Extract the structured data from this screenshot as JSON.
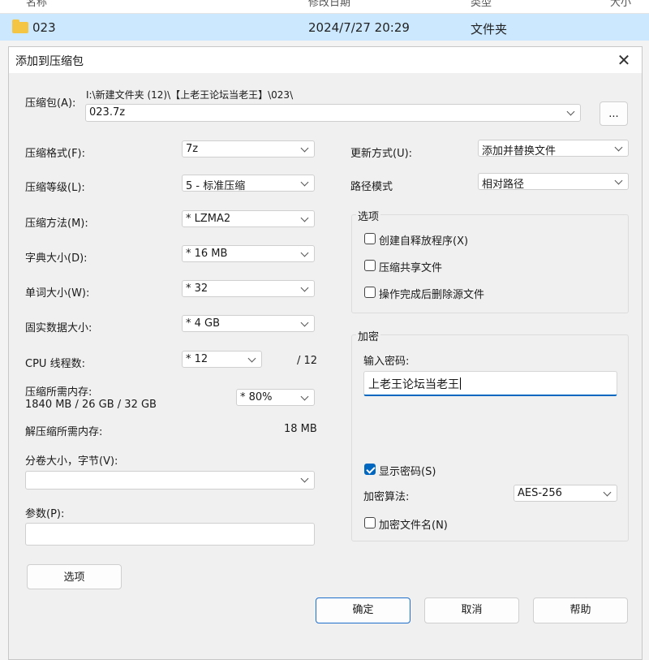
{
  "explorer": {
    "header_name": "名称",
    "header_modified": "修改日期",
    "header_type": "类型",
    "header_size": "大小",
    "row": {
      "name": "023",
      "modified": "2024/7/27 20:29",
      "type": "文件夹"
    }
  },
  "dialog": {
    "title": "添加到压缩包",
    "archive": {
      "label": "压缩包(A):",
      "path": "I:\\新建文件夹 (12)\\【上老王论坛当老王】\\023\\",
      "value": "023.7z",
      "browse_label": "..."
    },
    "left": {
      "format": {
        "label": "压缩格式(F):",
        "value": "7z"
      },
      "level": {
        "label": "压缩等级(L):",
        "value": "5 - 标准压缩"
      },
      "method": {
        "label": "压缩方法(M):",
        "value": "* LZMA2"
      },
      "dict": {
        "label": "字典大小(D):",
        "value": "* 16 MB"
      },
      "word": {
        "label": "单词大小(W):",
        "value": "* 32"
      },
      "solid": {
        "label": "固实数据大小:",
        "value": "* 4 GB"
      },
      "threads": {
        "label": "CPU 线程数:",
        "value": "* 12",
        "max": "/ 12"
      },
      "memory": {
        "label": "压缩所需内存:",
        "detail": "1840 MB / 26 GB / 32 GB",
        "value": "* 80%"
      },
      "decomp": {
        "label": "解压缩所需内存:",
        "value": "18 MB"
      },
      "volume": {
        "label": "分卷大小，字节(V):",
        "value": ""
      },
      "params": {
        "label": "参数(P):",
        "value": ""
      },
      "options_button": "选项"
    },
    "right": {
      "update": {
        "label": "更新方式(U):",
        "value": "添加并替换文件"
      },
      "pathmode": {
        "label": "路径模式",
        "value": "相对路径"
      },
      "options": {
        "title": "选项",
        "sfx": "创建自释放程序(X)",
        "shared": "压缩共享文件",
        "delete": "操作完成后删除源文件"
      },
      "encryption": {
        "title": "加密",
        "password_label": "输入密码:",
        "password_value": "上老王论坛当老王",
        "show_password": "显示密码(S)",
        "method_label": "加密算法:",
        "method_value": "AES-256",
        "encrypt_names": "加密文件名(N)"
      }
    },
    "buttons": {
      "ok": "确定",
      "cancel": "取消",
      "help": "帮助"
    }
  },
  "colors": {
    "accent": "#0067c0",
    "selection": "#cce8ff"
  }
}
